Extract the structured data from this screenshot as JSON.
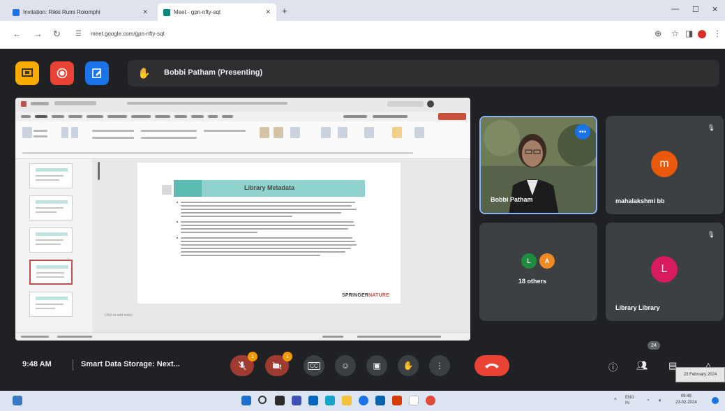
{
  "browser": {
    "tabs": [
      {
        "title": "Invitation: Rikki Rumi Roiomphi",
        "active": false
      },
      {
        "title": "Meet - gpn-nfty-sqt",
        "active": true
      }
    ],
    "url": "meet.google.com/gpn-nfty-sqt"
  },
  "meet": {
    "presenting_label": "Bobbi Patham (Presenting)",
    "time": "9:48 AM",
    "meeting_title": "Smart Data Storage: Next...",
    "participant_count": "24",
    "mic_badge": "1",
    "cam_badge": "1"
  },
  "slide": {
    "title": "Library Metadata",
    "logo_a": "SPRINGER",
    "logo_b": "NATURE",
    "notes_placeholder": "Click to add notes"
  },
  "participants": [
    {
      "name": "Bobbi Patham",
      "type": "video"
    },
    {
      "name": "mahalakshmi bb",
      "initial": "m",
      "color": "#e8590c"
    },
    {
      "name": "18 others",
      "initials": [
        "L",
        "A"
      ],
      "colors": [
        "#1e8e3e",
        "#f08a24"
      ]
    },
    {
      "name": "Library Library",
      "initial": "L",
      "color": "#d81b60"
    }
  ],
  "taskbar": {
    "clock_time": "09:48",
    "clock_date": "23-02-2024",
    "tooltip": "23 February 2024",
    "lang": "ENG IN"
  },
  "colors": {
    "meet_bg": "#202124",
    "end_call": "#ea4335",
    "active_border": "#8ab4f8",
    "slide_banner": "#8fd3cc"
  }
}
